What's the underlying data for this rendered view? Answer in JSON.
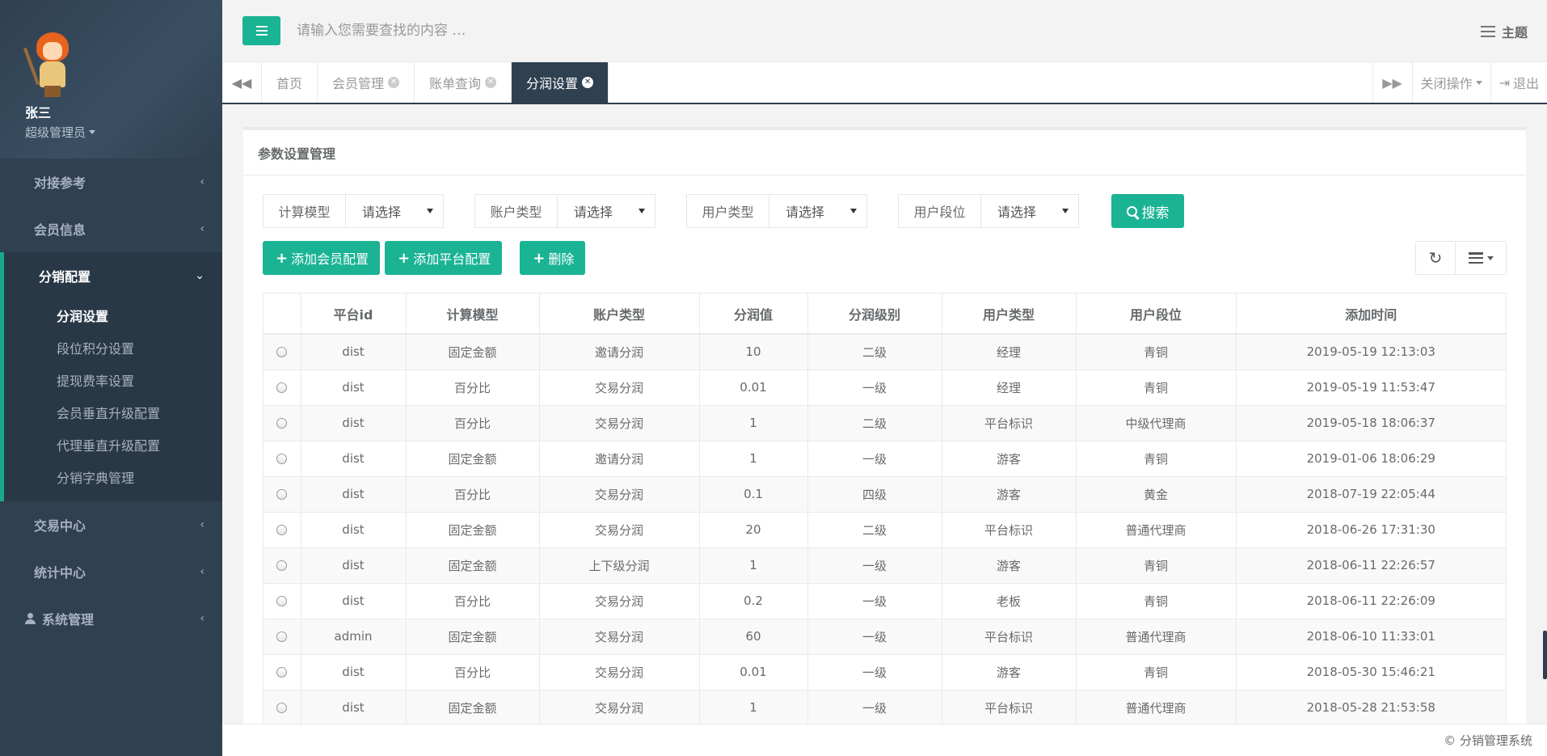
{
  "profile": {
    "name": "张三",
    "role": "超级管理员"
  },
  "sidebar": {
    "items": [
      {
        "label": "对接参考"
      },
      {
        "label": "会员信息"
      },
      {
        "label": "分销配置",
        "sub": [
          "分润设置",
          "段位积分设置",
          "提现费率设置",
          "会员垂直升级配置",
          "代理垂直升级配置",
          "分销字典管理"
        ]
      },
      {
        "label": "交易中心"
      },
      {
        "label": "统计中心"
      },
      {
        "label": "系统管理"
      }
    ]
  },
  "topbar": {
    "search_placeholder": "请输入您需要查找的内容 …",
    "theme_label": "主题"
  },
  "tabs": {
    "items": [
      "首页",
      "会员管理",
      "账单查询",
      "分润设置"
    ],
    "close_ops": "关闭操作",
    "logout": "退出"
  },
  "panel": {
    "title": "参数设置管理"
  },
  "filters": [
    {
      "label": "计算模型",
      "value": "请选择"
    },
    {
      "label": "账户类型",
      "value": "请选择"
    },
    {
      "label": "用户类型",
      "value": "请选择"
    },
    {
      "label": "用户段位",
      "value": "请选择"
    }
  ],
  "buttons": {
    "search": "搜索",
    "add_member": "添加会员配置",
    "add_platform": "添加平台配置",
    "delete": "删除"
  },
  "table": {
    "headers": [
      "平台id",
      "计算模型",
      "账户类型",
      "分润值",
      "分润级别",
      "用户类型",
      "用户段位",
      "添加时间"
    ],
    "rows": [
      [
        "dist",
        "固定金额",
        "邀请分润",
        "10",
        "二级",
        "经理",
        "青铜",
        "2019-05-19 12:13:03"
      ],
      [
        "dist",
        "百分比",
        "交易分润",
        "0.01",
        "一级",
        "经理",
        "青铜",
        "2019-05-19 11:53:47"
      ],
      [
        "dist",
        "百分比",
        "交易分润",
        "1",
        "二级",
        "平台标识",
        "中级代理商",
        "2019-05-18 18:06:37"
      ],
      [
        "dist",
        "固定金额",
        "邀请分润",
        "1",
        "一级",
        "游客",
        "青铜",
        "2019-01-06 18:06:29"
      ],
      [
        "dist",
        "百分比",
        "交易分润",
        "0.1",
        "四级",
        "游客",
        "黄金",
        "2018-07-19 22:05:44"
      ],
      [
        "dist",
        "固定金额",
        "交易分润",
        "20",
        "二级",
        "平台标识",
        "普通代理商",
        "2018-06-26 17:31:30"
      ],
      [
        "dist",
        "固定金额",
        "上下级分润",
        "1",
        "一级",
        "游客",
        "青铜",
        "2018-06-11 22:26:57"
      ],
      [
        "dist",
        "百分比",
        "交易分润",
        "0.2",
        "一级",
        "老板",
        "青铜",
        "2018-06-11 22:26:09"
      ],
      [
        "admin",
        "固定金额",
        "交易分润",
        "60",
        "一级",
        "平台标识",
        "普通代理商",
        "2018-06-10 11:33:01"
      ],
      [
        "dist",
        "百分比",
        "交易分润",
        "0.01",
        "一级",
        "游客",
        "青铜",
        "2018-05-30 15:46:21"
      ],
      [
        "dist",
        "固定金额",
        "交易分润",
        "1",
        "一级",
        "平台标识",
        "普通代理商",
        "2018-05-28 21:53:58"
      ]
    ]
  },
  "footer": {
    "text": "© 分销管理系统"
  },
  "colors": {
    "accent": "#1ab394",
    "sidebar": "#2f4050"
  }
}
